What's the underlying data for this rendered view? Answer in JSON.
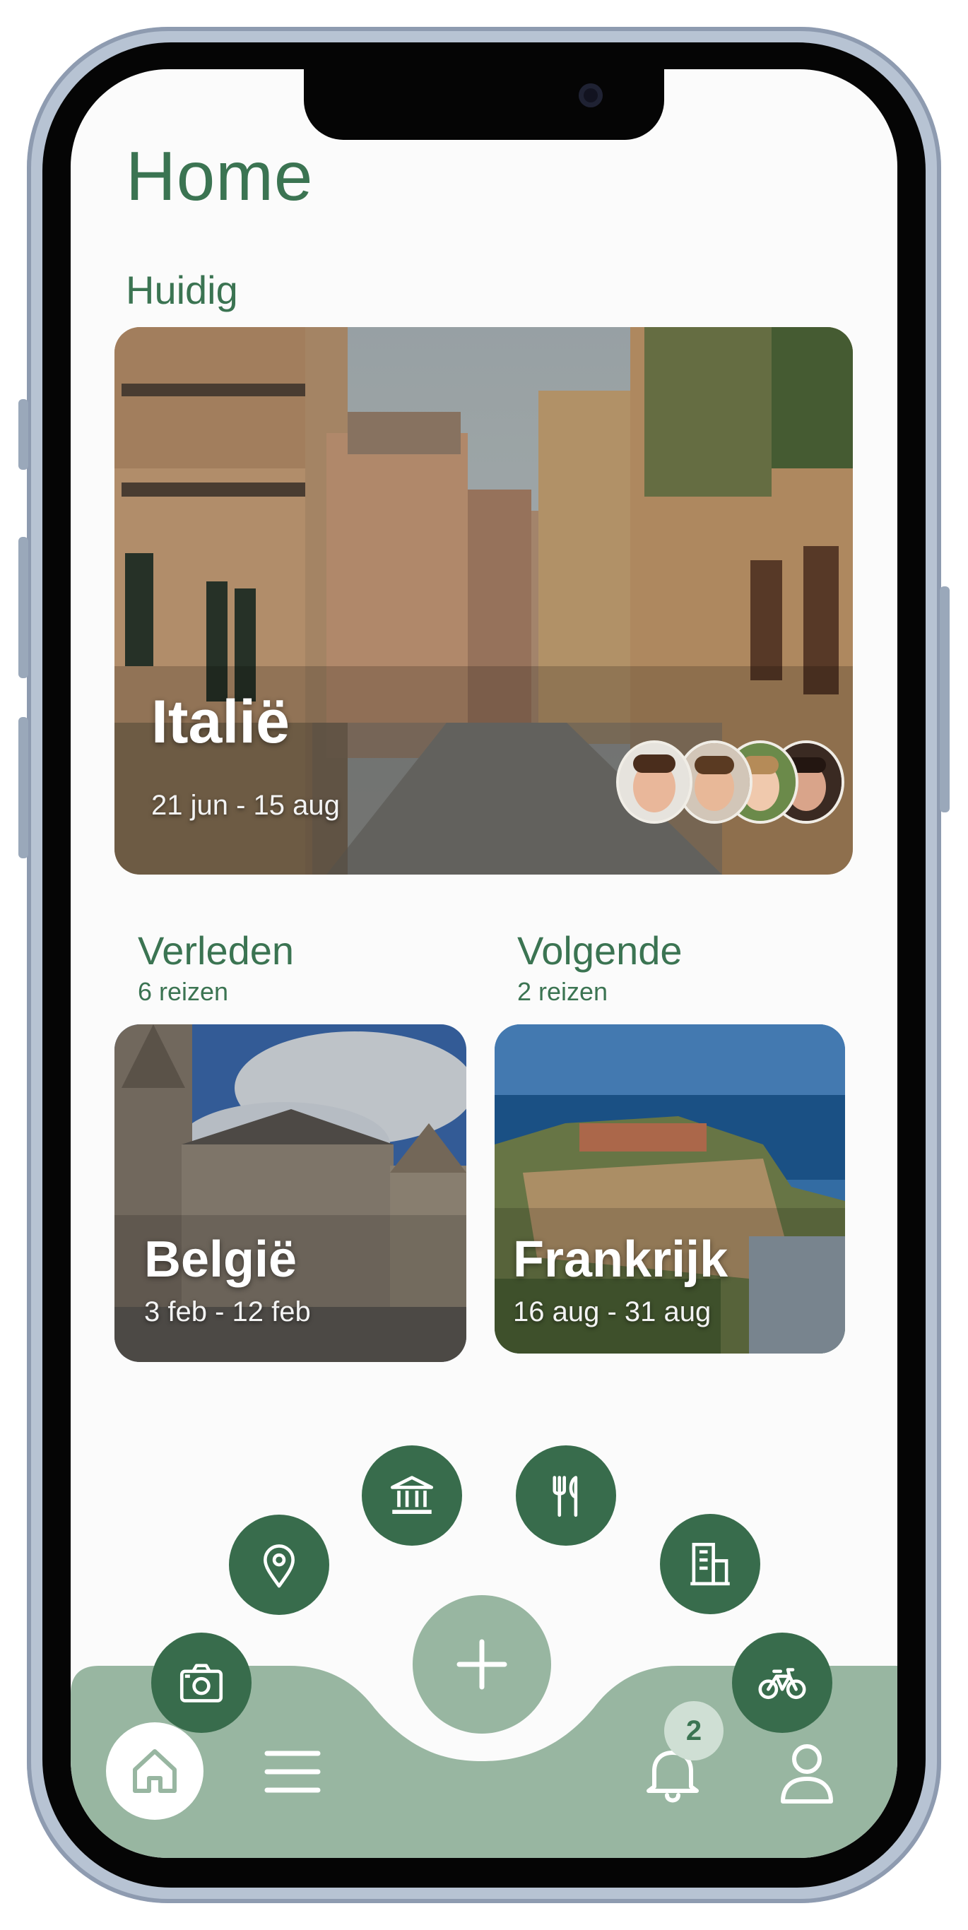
{
  "header": {
    "title": "Home"
  },
  "current": {
    "section_label": "Huidig",
    "trip": {
      "country": "Italië",
      "dates": "21 jun - 15 aug",
      "participants": 4
    }
  },
  "past": {
    "section_label": "Verleden",
    "count_label": "6 reizen",
    "trip": {
      "country": "België",
      "dates": "3 feb - 12 feb"
    }
  },
  "upcoming": {
    "section_label": "Volgende",
    "count_label": "2 reizen",
    "trip": {
      "country": "Frankrijk",
      "dates": "16 aug - 31 aug"
    }
  },
  "quick_actions": [
    "camera-icon",
    "location-pin-icon",
    "museum-icon",
    "restaurant-icon",
    "hotel-icon",
    "bicycle-icon"
  ],
  "tabbar": {
    "icons": [
      "home-icon",
      "menu-icon",
      "plus-icon",
      "bell-icon",
      "profile-icon"
    ],
    "notification_count": "2"
  },
  "colors": {
    "accent": "#3b7452",
    "fab": "#386c4c",
    "tabbar": "#98b6a1"
  }
}
